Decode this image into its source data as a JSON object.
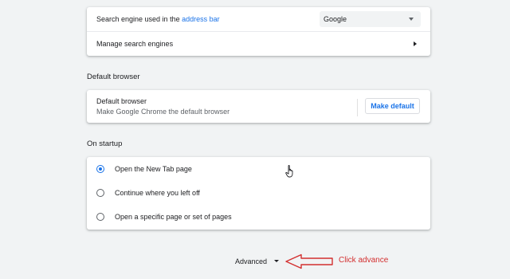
{
  "search_engine": {
    "label_prefix": "Search engine used in the ",
    "label_link": "address bar",
    "selected": "Google",
    "manage_label": "Manage search engines"
  },
  "default_browser": {
    "section_title": "Default browser",
    "title": "Default browser",
    "subtitle": "Make Google Chrome the default browser",
    "button_label": "Make default"
  },
  "on_startup": {
    "section_title": "On startup",
    "options": [
      {
        "label": "Open the New Tab page",
        "selected": true
      },
      {
        "label": "Continue where you left off",
        "selected": false
      },
      {
        "label": "Open a specific page or set of pages",
        "selected": false
      }
    ]
  },
  "advanced": {
    "label": "Advanced"
  },
  "annotation": {
    "text": "Click advance",
    "color": "#d32f2f"
  },
  "colors": {
    "accent": "#1a73e8",
    "background": "#f1f3f4"
  }
}
